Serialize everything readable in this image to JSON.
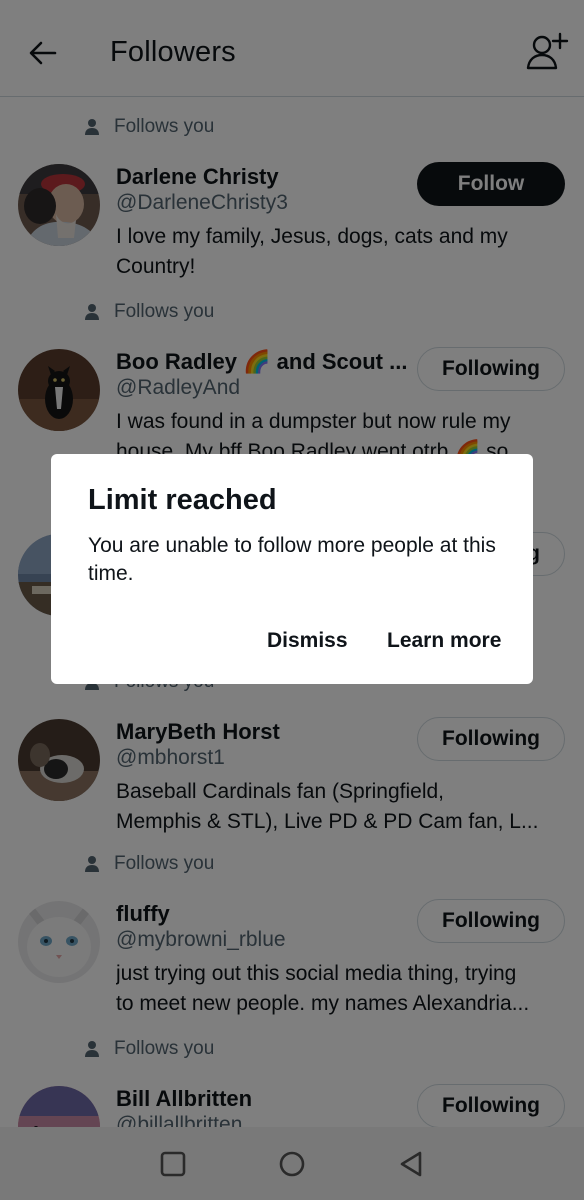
{
  "header": {
    "title": "Followers"
  },
  "follows_you_label": "Follows you",
  "users": [
    {
      "name": "Darlene Christy",
      "handle": "@DarleneChristy3",
      "bio": [
        "I love my family, Jesus, dogs, cats and my",
        "Country!"
      ],
      "button": "Follow"
    },
    {
      "name": "Boo Radley 🌈 and Scout ...",
      "handle": "@RadleyAnd",
      "bio": [
        "I was found in a dumpster but now rule my",
        "house. My bff Boo Radley went otrb 🌈 so..."
      ],
      "button": "Following"
    },
    {
      "name": "",
      "handle": "",
      "bio": [
        "",
        ""
      ],
      "button": "Following"
    },
    {
      "name": "MaryBeth Horst",
      "handle": "@mbhorst1",
      "bio": [
        "Baseball Cardinals fan (Springfield,",
        "Memphis & STL), Live PD & PD Cam fan, L..."
      ],
      "button": "Following"
    },
    {
      "name": "fluffy",
      "handle": "@mybrowni_rblue",
      "bio": [
        "just trying out this social media thing, trying",
        "to meet new people. my names Alexandria..."
      ],
      "button": "Following"
    },
    {
      "name": "Bill Allbritten",
      "handle": "@billallbritten",
      "bio": [
        "",
        ""
      ],
      "button": "Following"
    }
  ],
  "dialog": {
    "title": "Limit reached",
    "message": "You are unable to follow more people at this time.",
    "dismiss": "Dismiss",
    "learn_more": "Learn more"
  },
  "icons": {
    "back": "arrow-left-icon",
    "add_user": "add-user-icon",
    "person": "person-icon",
    "nav_recent": "square-icon",
    "nav_home": "circle-icon",
    "nav_back": "triangle-icon"
  }
}
